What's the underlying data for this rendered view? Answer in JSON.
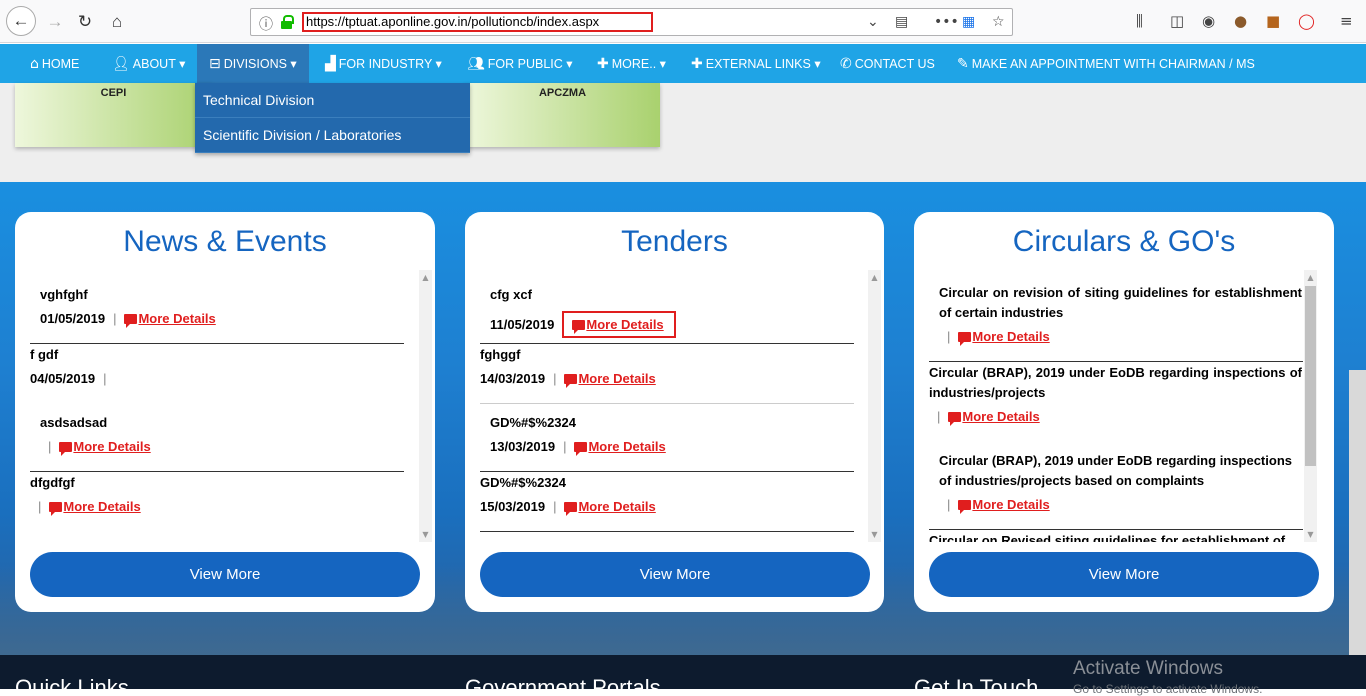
{
  "browser": {
    "url": "https://tptuat.aponline.gov.in/pollutioncb/index.aspx",
    "back_icon": "arrow-left",
    "forward_icon": "arrow-right",
    "reload_icon": "reload",
    "home_icon": "home"
  },
  "nav": {
    "items": [
      {
        "label": "HOME",
        "icon": "home-icon"
      },
      {
        "label": "ABOUT ▾",
        "icon": "user-icon"
      },
      {
        "label": "DIVISIONS ▾",
        "icon": "minus-square-icon"
      },
      {
        "label": "FOR INDUSTRY ▾",
        "icon": "chart-icon"
      },
      {
        "label": "FOR PUBLIC ▾",
        "icon": "users-icon"
      },
      {
        "label": "MORE.. ▾",
        "icon": "plus-icon"
      },
      {
        "label": "EXTERNAL LINKS ▾",
        "icon": "plus-icon"
      },
      {
        "label": "CONTACT US",
        "icon": "phone-icon"
      },
      {
        "label": "MAKE AN APPOINTMENT WITH CHAIRMAN / MS",
        "icon": "edit-icon"
      }
    ],
    "dropdown": [
      "Technical Division",
      "Scientific Division / Laboratories"
    ]
  },
  "tiles": {
    "left": "CEPI",
    "right": "APCZMA"
  },
  "news": {
    "title": "News & Events",
    "items": [
      {
        "title": "vghfghf",
        "date": "01/05/2019",
        "more": "More Details"
      },
      {
        "title": "f gdf",
        "date": "04/05/2019"
      },
      {
        "title": "asdsadsad",
        "more": "More Details"
      },
      {
        "title": "dfgdfgf",
        "more": "More Details"
      }
    ],
    "button": "View More"
  },
  "tenders": {
    "title": "Tenders",
    "items": [
      {
        "title": "cfg xcf",
        "date": "11/05/2019",
        "more": "More Details"
      },
      {
        "title": "fghggf",
        "date": "14/03/2019",
        "more": "More Details"
      },
      {
        "title": "GD%#$%2324",
        "date": "13/03/2019",
        "more": "More Details"
      },
      {
        "title": "GD%#$%2324",
        "date": "15/03/2019",
        "more": "More Details"
      }
    ],
    "button": "View More"
  },
  "circulars": {
    "title": "Circulars & GO's",
    "items": [
      {
        "title": "Circular on revision of siting guidelines for establishment of certain industries",
        "more": "More Details"
      },
      {
        "title": "Circular (BRAP), 2019 under EoDB regarding inspections of industries/projects",
        "more": "More Details"
      },
      {
        "title": "Circular (BRAP), 2019 under EoDB regarding inspections of industries/projects based on complaints",
        "more": "More Details"
      },
      {
        "title": "Circular on Revised siting guidelines for establishment of"
      }
    ],
    "button": "View More"
  },
  "footer": {
    "cols": [
      "Quick Links",
      "Government Portals",
      "Get In Touch"
    ]
  },
  "watermark": {
    "line1": "Activate Windows",
    "line2": "Go to Settings to activate Windows."
  }
}
